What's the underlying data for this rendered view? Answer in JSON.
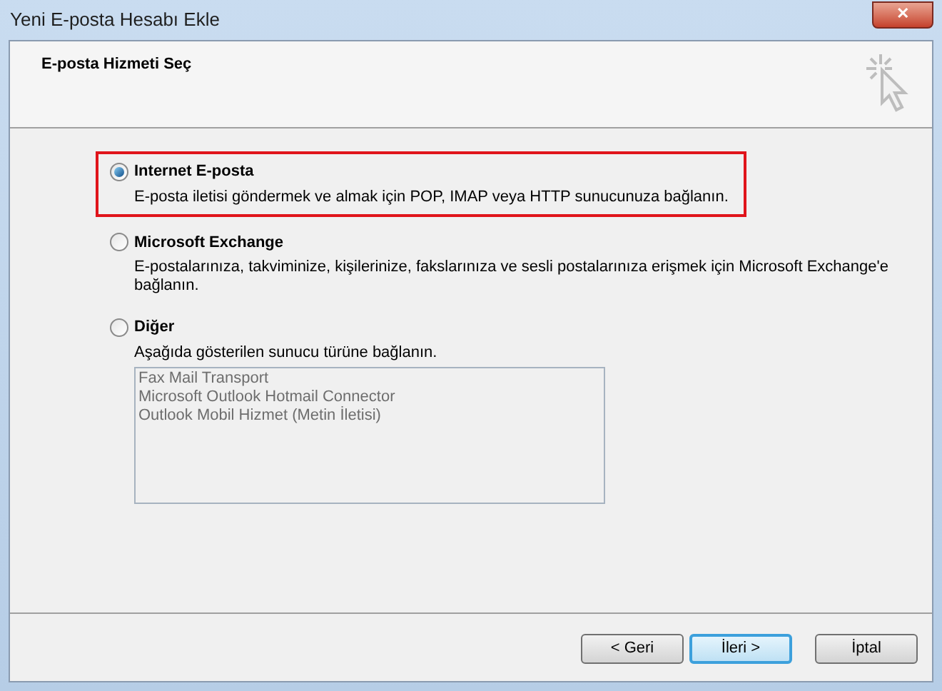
{
  "window": {
    "title": "Yeni E-posta Hesabı Ekle",
    "close_label": "✕"
  },
  "header": {
    "title": "E-posta Hizmeti Seç"
  },
  "options": [
    {
      "label": "Internet E-posta",
      "description": "E-posta iletisi göndermek ve almak için POP, IMAP veya HTTP sunucunuza bağlanın.",
      "selected": true,
      "highlighted": true
    },
    {
      "label": "Microsoft Exchange",
      "description": "E-postalarınıza, takviminize, kişilerinize, fakslarınıza ve sesli postalarınıza erişmek için Microsoft Exchange'e bağlanın.",
      "selected": false,
      "highlighted": false
    },
    {
      "label": "Diğer",
      "description": "Aşağıda gösterilen sunucu türüne bağlanın.",
      "selected": false,
      "highlighted": false,
      "list": {
        "disabled": true,
        "items": [
          "Fax Mail Transport",
          "Microsoft Outlook Hotmail Connector",
          "Outlook Mobil Hizmet (Metin İletisi)"
        ]
      }
    }
  ],
  "buttons": [
    {
      "label": "< Geri",
      "default": false
    },
    {
      "label": "İleri >",
      "default": true
    },
    {
      "label": "İptal",
      "default": false
    }
  ]
}
